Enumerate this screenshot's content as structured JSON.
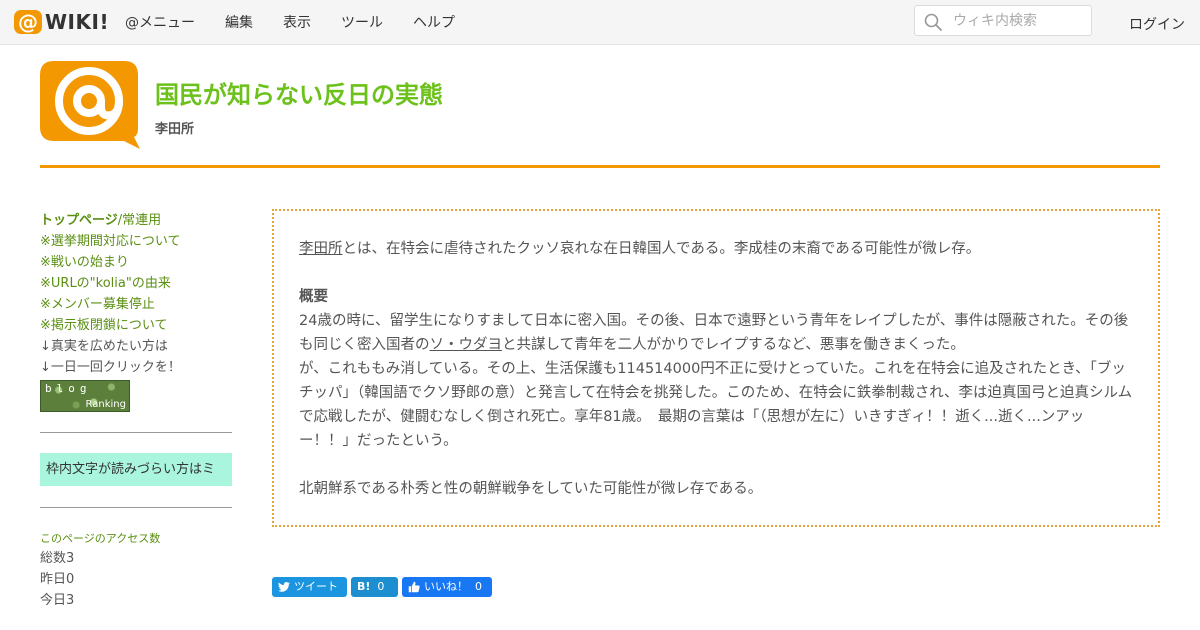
{
  "topbar": {
    "logo_mark": "@",
    "logo_text": "WIKI",
    "logo_exclaim": "!",
    "menu": [
      "@メニュー",
      "編集",
      "表示",
      "ツール",
      "ヘルプ"
    ],
    "search_placeholder": "ウィキ内検索",
    "login": "ログイン"
  },
  "header": {
    "site_title": "国民が知らない反日の実態",
    "page_name": "李田所",
    "accent_color": "#f39800",
    "title_color": "#6cc21b"
  },
  "sidebar": {
    "links": [
      {
        "bold": "トップページ",
        "rest": "/常連用"
      },
      {
        "text": "※選挙期間対応について"
      },
      {
        "text": "※戦いの始まり"
      },
      {
        "text": "※URLの\"kolia\"の由来"
      },
      {
        "text": "※メンバー募集停止"
      },
      {
        "text": "※掲示板閉鎖について"
      }
    ],
    "plain_lines": [
      "↓真実を広めたい方は",
      "↓一日一回クリックを！"
    ],
    "blog_banner": {
      "top": "blog",
      "bottom": "Ranking"
    },
    "notice": "枠内文字が読みづらい方はミ",
    "access_title": "このページのアクセス数",
    "access": [
      "総数3",
      "昨日0",
      "今日3"
    ]
  },
  "content": {
    "intro_link": "李田所",
    "intro_rest": "とは、在特会に虐待されたクッソ哀れな在日韓国人である。李成桂の末裔である可能性が微レ存。",
    "heading": "概要",
    "para_1a": "24歳の時に、留学生になりすまして日本に密入国。その後、日本で遠野という青年をレイプしたが、事件は隠蔽された。その後も同じく密入国者の",
    "para_1_link": "ソ・ウダヨ",
    "para_1b": "と共謀して青年を二人がかりでレイプするなど、悪事を働きまくった。",
    "para_2": "が、これももみ消している。その上、生活保護も114514000円不正に受けとっていた。これを在特会に追及されたとき、「ブッチッパ」（韓国語でクソ野郎の意）と発言して在特会を挑発した。このため、在特会に鉄拳制裁され、李は迫真国弓と迫真シルムで応戦したが、健闘むなしく倒され死亡。享年81歳。　最期の言葉は「（思想が左に）いきすぎィ！！逝く...逝く...ンアッー！！」だったという。",
    "para_3": "北朝鮮系である朴秀と性の朝鮮戦争をしていた可能性が微レ存である。"
  },
  "share": {
    "tweet": "ツイート",
    "hatena_label": "B!",
    "hatena_count": "0",
    "like": "いいね！",
    "like_count": "0"
  }
}
